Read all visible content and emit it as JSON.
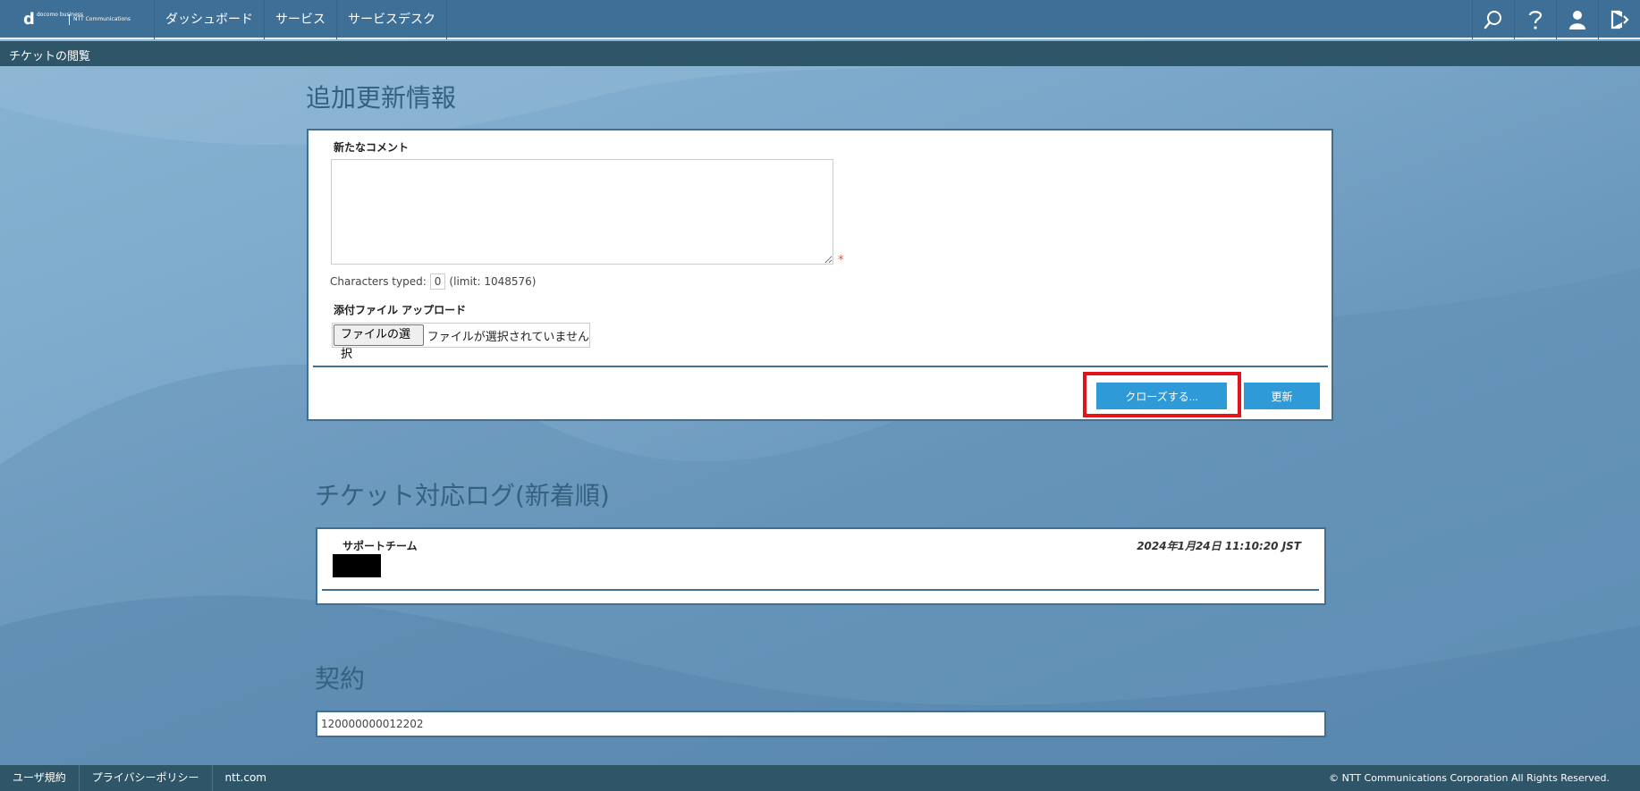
{
  "header": {
    "logo_text_1": "docomo business",
    "logo_text_2": "NTT Communications",
    "nav": [
      "ダッシュボード",
      "サービス",
      "サービスデスク"
    ],
    "icons": [
      "search-icon",
      "help-icon",
      "user-icon",
      "logout-icon"
    ]
  },
  "breadcrumb": "チケットの閲覧",
  "update_section": {
    "title": "追加更新情報",
    "comment_label": "新たなコメント",
    "comment_value": "",
    "required_mark": "*",
    "chars_typed_label": "Characters typed:",
    "chars_typed_value": "0",
    "chars_limit": "(limit: 1048576)",
    "attachment_label": "添付ファイル アップロード",
    "file_button": "ファイルの選択",
    "file_status": "ファイルが選択されていません",
    "close_button": "クローズする...",
    "update_button": "更新"
  },
  "log_section": {
    "title": "チケット対応ログ(新着順)",
    "entries": [
      {
        "author": "サポートチーム",
        "date": "2024年1月24日 11:10:20 JST"
      }
    ]
  },
  "contract_section": {
    "title": "契約",
    "value": "120000000012202"
  },
  "footer": {
    "links": [
      "ユーザ規約",
      "プライバシーポリシー",
      "ntt.com"
    ],
    "copyright": "© NTT Communications Corporation All Rights Reserved."
  },
  "colors": {
    "header_bg": "#3e6f96",
    "subbar_bg": "#2e5568",
    "accent_button": "#2e9bd8",
    "highlight_red": "#e0141a",
    "panel_border": "#3f6f94"
  }
}
